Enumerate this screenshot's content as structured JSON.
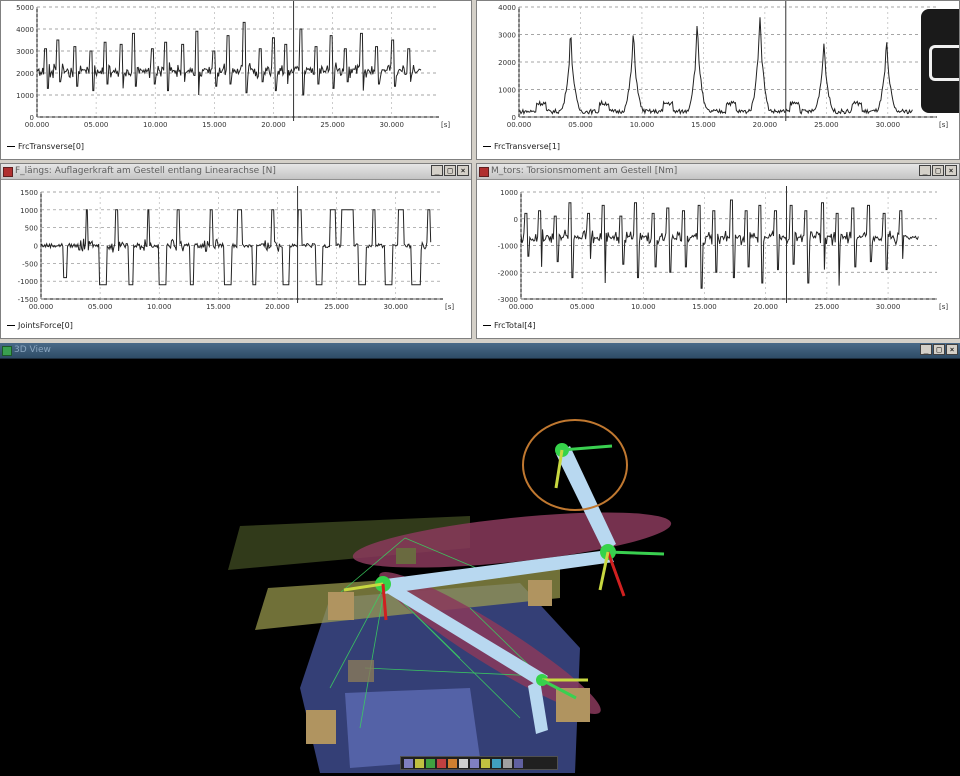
{
  "time_unit": "[s]",
  "windows": {
    "top_left": {
      "title": "",
      "legend": "FrcTransverse[0]"
    },
    "top_right": {
      "title": "",
      "legend": "FrcTransverse[1]"
    },
    "mid_left": {
      "title": "F_längs: Auflagerkraft am Gestell entlang Linearachse [N]",
      "legend": "JointsForce[0]"
    },
    "mid_right": {
      "title": "M_tors: Torsionsmoment am Gestell [Nm]",
      "legend": "FrcTotal[4]"
    },
    "view3d": {
      "title": "3D View"
    }
  },
  "window_buttons": {
    "minimize": "_",
    "maximize": "□",
    "close": "×"
  },
  "chart_data": [
    {
      "type": "line",
      "name": "top-left",
      "legend": "FrcTransverse[0]",
      "x_ticks": [
        "00.000",
        "05.000",
        "10.000",
        "15.000",
        "20.000",
        "25.000",
        "30.000"
      ],
      "xlim": [
        0,
        34
      ],
      "y_ticks": [
        "0",
        "1000",
        "2000",
        "3000",
        "4000",
        "5000"
      ],
      "ylim": [
        0,
        5000
      ],
      "baseline": 2100,
      "spikes": [
        {
          "t": 0.7,
          "h": 3100,
          "l": 1300
        },
        {
          "t": 1.8,
          "h": 3500,
          "l": 1600
        },
        {
          "t": 3.2,
          "h": 3200,
          "l": 1400
        },
        {
          "t": 4.6,
          "h": 3000,
          "l": 1200
        },
        {
          "t": 5.8,
          "h": 3400,
          "l": 1500
        },
        {
          "t": 7.1,
          "h": 3300,
          "l": 1300
        },
        {
          "t": 8.2,
          "h": 3800,
          "l": 1400
        },
        {
          "t": 9.8,
          "h": 3100,
          "l": 1500
        },
        {
          "t": 10.9,
          "h": 3400,
          "l": 1200
        },
        {
          "t": 12.3,
          "h": 3300,
          "l": 1600
        },
        {
          "t": 13.5,
          "h": 3900,
          "l": 1000
        },
        {
          "t": 15.0,
          "h": 3000,
          "l": 1400
        },
        {
          "t": 16.2,
          "h": 3700,
          "l": 1500
        },
        {
          "t": 17.5,
          "h": 4300,
          "l": 1100
        },
        {
          "t": 18.9,
          "h": 3100,
          "l": 1600
        },
        {
          "t": 20.0,
          "h": 3600,
          "l": 1200
        },
        {
          "t": 21.0,
          "h": 3300,
          "l": 1500
        },
        {
          "t": 22.3,
          "h": 4000,
          "l": 1000
        },
        {
          "t": 23.6,
          "h": 3200,
          "l": 1500
        },
        {
          "t": 24.9,
          "h": 3700,
          "l": 1300
        },
        {
          "t": 26.1,
          "h": 3100,
          "l": 1600
        },
        {
          "t": 27.4,
          "h": 3800,
          "l": 1200
        },
        {
          "t": 28.7,
          "h": 3200,
          "l": 1500
        },
        {
          "t": 30.1,
          "h": 3500,
          "l": 1400
        },
        {
          "t": 31.4,
          "h": 3100,
          "l": 1600
        }
      ],
      "cursor_t": 21.7,
      "end_t": 32.5
    },
    {
      "type": "line",
      "name": "top-right",
      "legend": "FrcTransverse[1]",
      "x_ticks": [
        "00.000",
        "05.000",
        "10.000",
        "15.000",
        "20.000",
        "25.000",
        "30.000"
      ],
      "xlim": [
        0,
        34
      ],
      "y_ticks": [
        "0",
        "1000",
        "2000",
        "3000",
        "4000"
      ],
      "ylim": [
        0,
        4000
      ],
      "baseline": 200,
      "peaks": [
        {
          "t": 4.2,
          "h": 3000
        },
        {
          "t": 9.3,
          "h": 3000
        },
        {
          "t": 14.5,
          "h": 3300
        },
        {
          "t": 19.6,
          "h": 3700
        },
        {
          "t": 24.8,
          "h": 2700
        },
        {
          "t": 29.9,
          "h": 2700
        }
      ],
      "cursor_t": 21.7,
      "end_t": 32.0
    },
    {
      "type": "line",
      "name": "mid-left",
      "legend": "JointsForce[0]",
      "x_ticks": [
        "00.000",
        "05.000",
        "10.000",
        "15.000",
        "20.000",
        "25.000",
        "30.000"
      ],
      "xlim": [
        0,
        34
      ],
      "y_ticks": [
        "-1500",
        "-1000",
        "-500",
        "0",
        "500",
        "1000",
        "1500"
      ],
      "ylim": [
        -1500,
        1500
      ],
      "baseline": 0,
      "pulses": [
        {
          "t": 1.9,
          "w": 0.3,
          "h": -900
        },
        {
          "t": 3.8,
          "w": 0.2,
          "h": 1000
        },
        {
          "t": 4.9,
          "w": 0.7,
          "h": -1100
        },
        {
          "t": 6.3,
          "w": 0.2,
          "h": 1000
        },
        {
          "t": 7.4,
          "w": 0.4,
          "h": -1100
        },
        {
          "t": 9.0,
          "w": 0.2,
          "h": 1000
        },
        {
          "t": 10.0,
          "w": 0.6,
          "h": -1100
        },
        {
          "t": 11.5,
          "w": 0.2,
          "h": 1000
        },
        {
          "t": 12.6,
          "w": 0.3,
          "h": -1100
        },
        {
          "t": 14.3,
          "w": 0.2,
          "h": 1000
        },
        {
          "t": 15.5,
          "w": 0.6,
          "h": -1100
        },
        {
          "t": 16.6,
          "w": 0.4,
          "h": 1000
        },
        {
          "t": 17.9,
          "w": 0.3,
          "h": -1100
        },
        {
          "t": 19.5,
          "w": 0.2,
          "h": 1000
        },
        {
          "t": 20.4,
          "w": 0.6,
          "h": -1100
        },
        {
          "t": 21.7,
          "w": 0.3,
          "h": 1000
        },
        {
          "t": 23.2,
          "w": 0.6,
          "h": -1100
        },
        {
          "t": 24.4,
          "w": 0.5,
          "h": 1000
        },
        {
          "t": 25.4,
          "w": 1.0,
          "h": 1000
        },
        {
          "t": 26.8,
          "w": 0.7,
          "h": -1100
        },
        {
          "t": 28.0,
          "w": 0.3,
          "h": 1000
        },
        {
          "t": 29.1,
          "w": 0.6,
          "h": -1100
        },
        {
          "t": 30.2,
          "w": 0.5,
          "h": 1000
        },
        {
          "t": 31.3,
          "w": 0.8,
          "h": -1100
        },
        {
          "t": 32.7,
          "w": 0.2,
          "h": 1000
        }
      ],
      "cursor_t": 21.7,
      "end_t": 33.0
    },
    {
      "type": "line",
      "name": "mid-right",
      "legend": "FrcTotal[4]",
      "x_ticks": [
        "00.000",
        "05.000",
        "10.000",
        "15.000",
        "20.000",
        "25.000",
        "30.000"
      ],
      "xlim": [
        0,
        34
      ],
      "y_ticks": [
        "-3000",
        "-2000",
        "-1000",
        "0",
        "1000"
      ],
      "ylim": [
        -3000,
        1000
      ],
      "baseline": -700,
      "spikes": [
        {
          "t": 0.4,
          "h": 200,
          "l": -1400
        },
        {
          "t": 1.5,
          "h": 300,
          "l": -1800
        },
        {
          "t": 2.8,
          "h": 100,
          "l": -1600
        },
        {
          "t": 4.0,
          "h": 600,
          "l": -2200
        },
        {
          "t": 5.5,
          "h": 200,
          "l": -1500
        },
        {
          "t": 6.7,
          "h": 500,
          "l": -2400
        },
        {
          "t": 8.2,
          "h": 100,
          "l": -1700
        },
        {
          "t": 9.4,
          "h": 600,
          "l": -2200
        },
        {
          "t": 10.8,
          "h": 200,
          "l": -1800
        },
        {
          "t": 12.0,
          "h": 400,
          "l": -2000
        },
        {
          "t": 13.3,
          "h": 300,
          "l": -1800
        },
        {
          "t": 14.6,
          "h": 500,
          "l": -2600
        },
        {
          "t": 15.8,
          "h": 300,
          "l": -2000
        },
        {
          "t": 17.2,
          "h": 700,
          "l": -2200
        },
        {
          "t": 18.4,
          "h": 300,
          "l": -1800
        },
        {
          "t": 19.5,
          "h": 500,
          "l": -2400
        },
        {
          "t": 20.8,
          "h": 300,
          "l": -1900
        },
        {
          "t": 22.1,
          "h": 500,
          "l": -1700
        },
        {
          "t": 23.3,
          "h": 300,
          "l": -2400
        },
        {
          "t": 24.6,
          "h": 600,
          "l": -1900
        },
        {
          "t": 25.8,
          "h": 200,
          "l": -2500
        },
        {
          "t": 27.1,
          "h": 400,
          "l": -1800
        },
        {
          "t": 28.4,
          "h": 500,
          "l": -1600
        },
        {
          "t": 29.7,
          "h": 200,
          "l": -1900
        },
        {
          "t": 31.0,
          "h": 300,
          "l": -1500
        }
      ],
      "cursor_t": 21.7,
      "end_t": 32.5
    }
  ]
}
